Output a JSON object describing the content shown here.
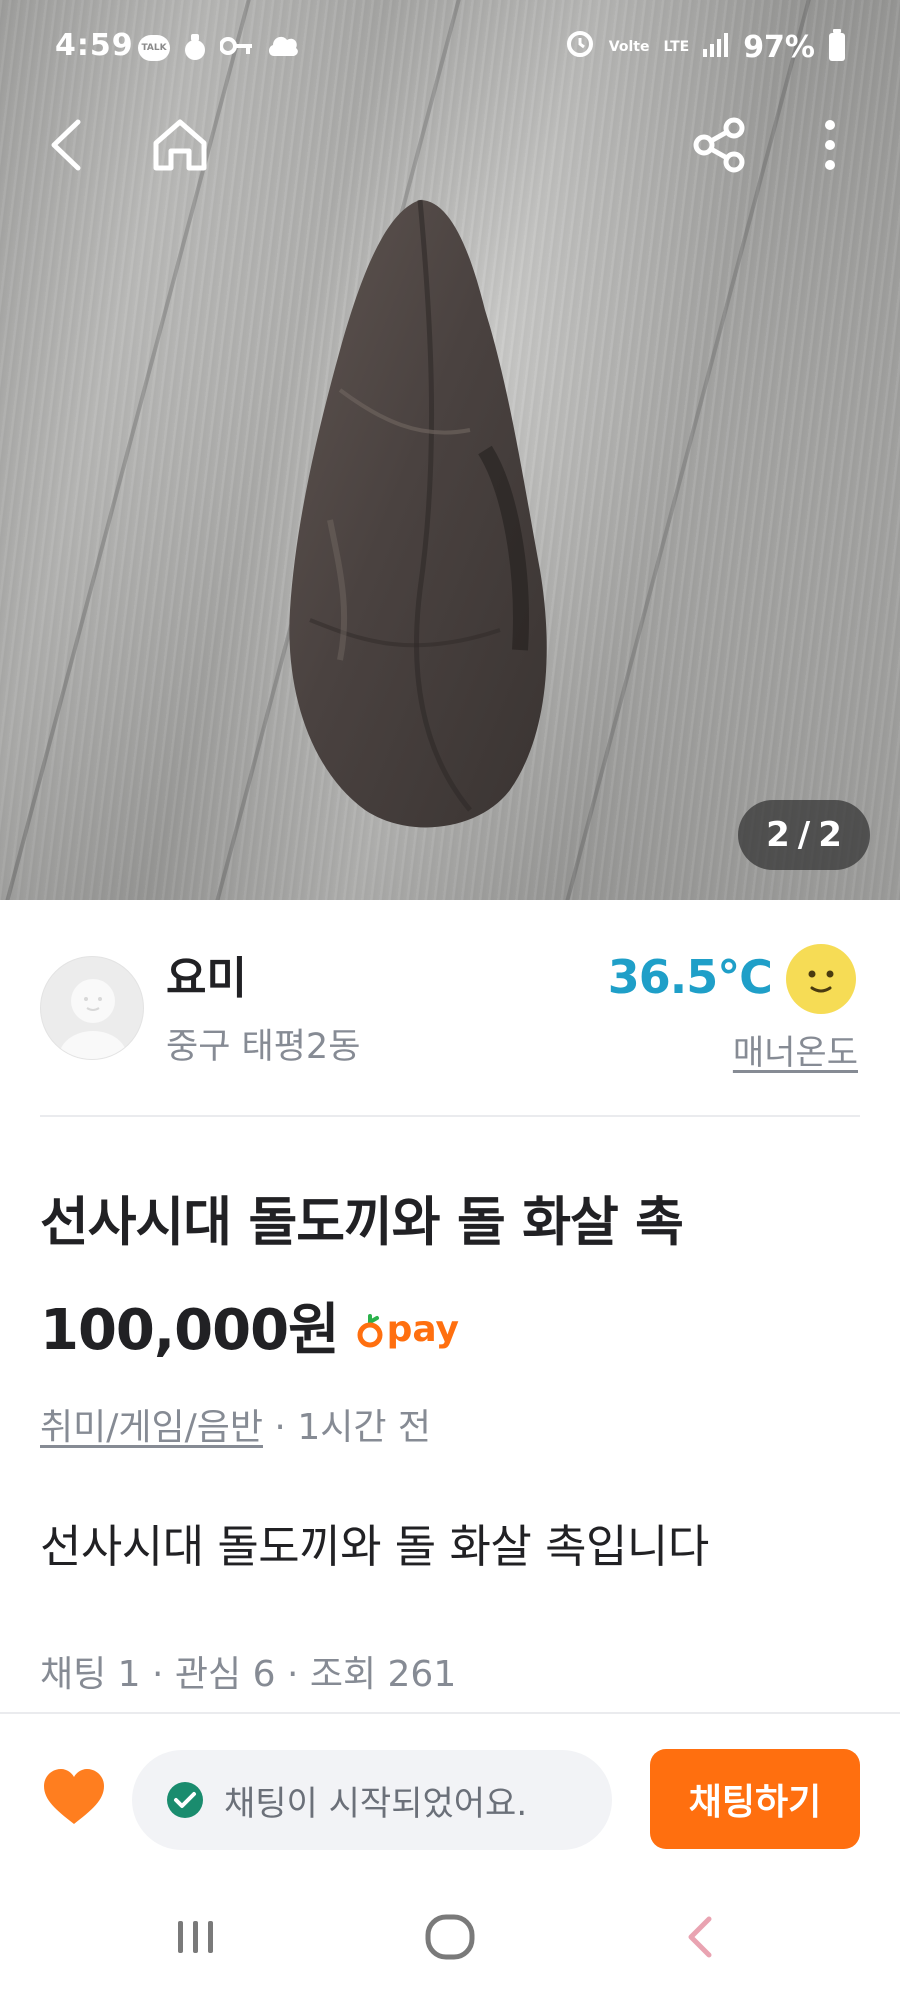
{
  "status_bar": {
    "time": "4:59",
    "talk_badge": "TALK",
    "volte": "Volte",
    "network": "LTE",
    "battery": "97%"
  },
  "gallery": {
    "counter_current": "2",
    "counter_sep": "/",
    "counter_total": "2"
  },
  "seller": {
    "name": "요미",
    "location": "중구 태평2동",
    "temperature": "36.5℃",
    "manner_label": "매너온도"
  },
  "product": {
    "title": "선사시대 돌도끼와 돌 화살 촉",
    "price": "100,000원",
    "pay_label": "pay",
    "category": "취미/게임/음반",
    "meta_sep": " · ",
    "posted": "1시간 전",
    "description": "선사시대 돌도끼와 돌 화살 촉입니다",
    "stats": "채팅 1 · 관심 6 · 조회 261"
  },
  "action_bar": {
    "notice": "채팅이 시작되었어요.",
    "chat_button": "채팅하기"
  },
  "colors": {
    "accent": "#ff6f0f",
    "temperature": "#1f9fc8",
    "notice_check": "#1a8c6e",
    "muted_text": "#868b94"
  },
  "icons": {
    "back": "back-arrow-icon",
    "home": "home-icon",
    "share": "share-icon",
    "more": "more-vertical-icon",
    "heart": "heart-icon",
    "check": "check-circle-icon"
  }
}
